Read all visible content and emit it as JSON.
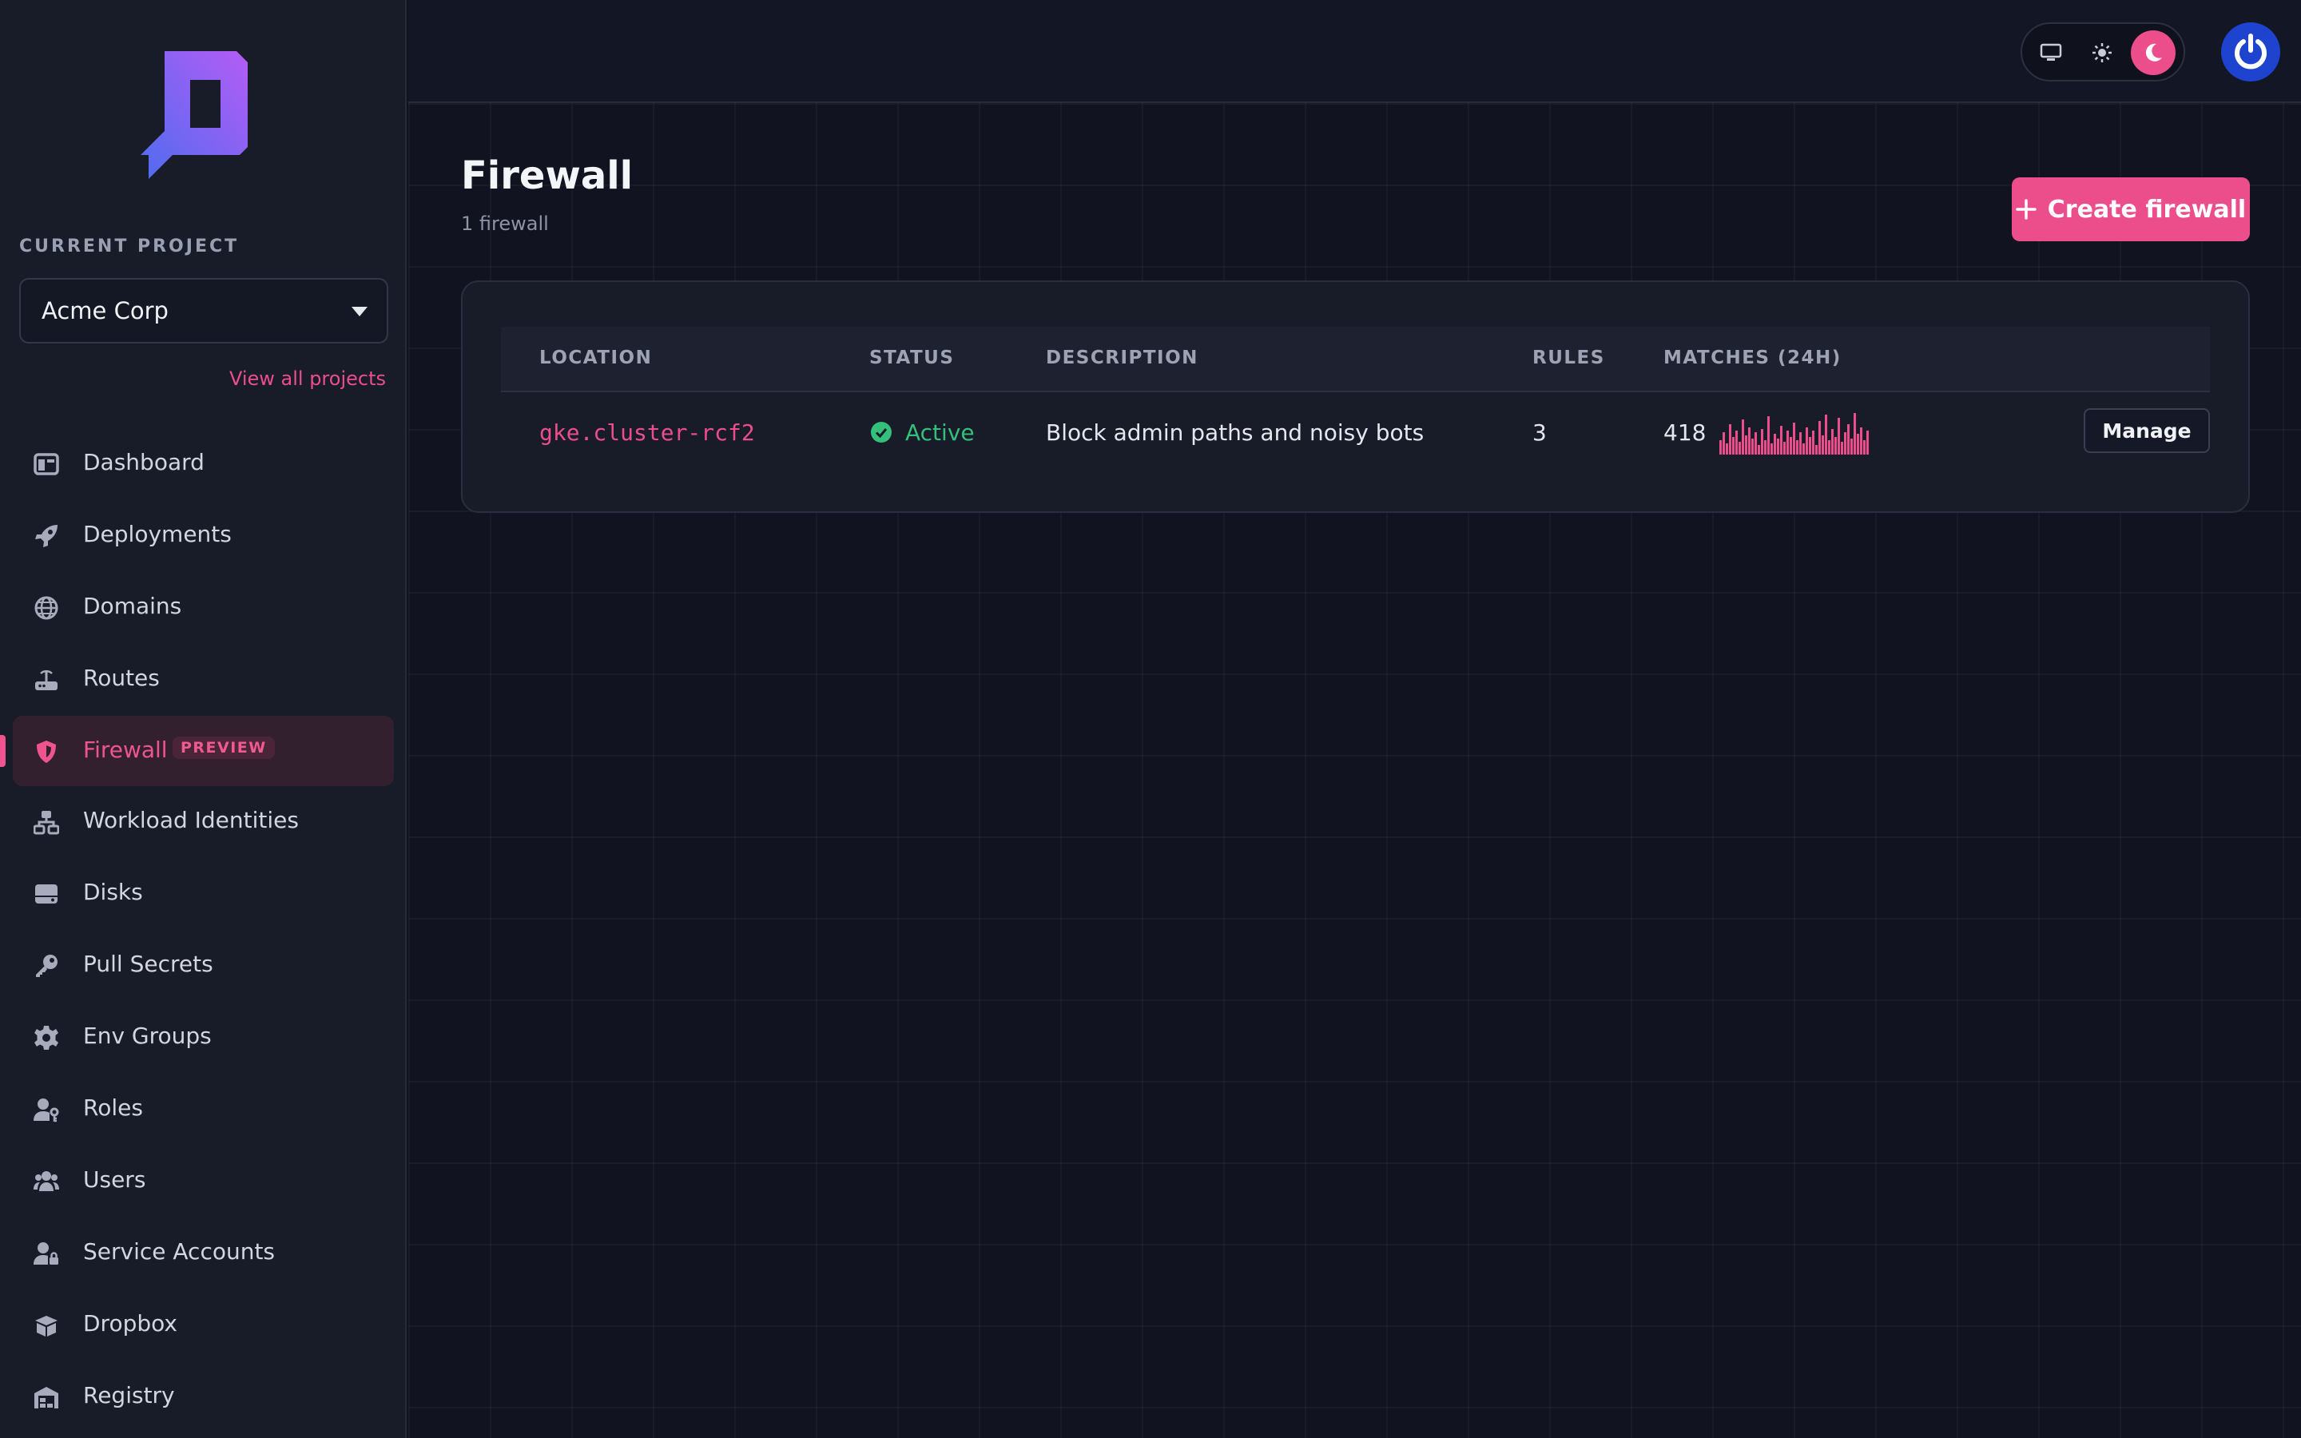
{
  "sidebar": {
    "current_project_label": "CURRENT PROJECT",
    "project_name": "Acme Corp",
    "view_all_projects": "View all projects",
    "items": [
      {
        "label": "Dashboard",
        "icon": "dashboard-icon"
      },
      {
        "label": "Deployments",
        "icon": "rocket-icon"
      },
      {
        "label": "Domains",
        "icon": "globe-icon"
      },
      {
        "label": "Routes",
        "icon": "router-icon"
      },
      {
        "label": "Firewall",
        "icon": "shield-icon",
        "active": true,
        "badge": "PREVIEW"
      },
      {
        "label": "Workload Identities",
        "icon": "network-icon"
      },
      {
        "label": "Disks",
        "icon": "disk-icon"
      },
      {
        "label": "Pull Secrets",
        "icon": "key-icon"
      },
      {
        "label": "Env Groups",
        "icon": "gear-icon"
      },
      {
        "label": "Roles",
        "icon": "user-key-icon"
      },
      {
        "label": "Users",
        "icon": "users-icon"
      },
      {
        "label": "Service Accounts",
        "icon": "user-lock-icon"
      },
      {
        "label": "Dropbox",
        "icon": "box-icon"
      },
      {
        "label": "Registry",
        "icon": "warehouse-icon"
      }
    ]
  },
  "header": {
    "theme_options": [
      "monitor-icon",
      "sun-icon",
      "moon-icon"
    ],
    "theme_selected": "dark"
  },
  "main": {
    "title": "Firewall",
    "subtitle": "1 firewall",
    "create_button": "Create firewall",
    "table": {
      "columns": [
        "LOCATION",
        "STATUS",
        "DESCRIPTION",
        "RULES",
        "MATCHES (24H)"
      ],
      "rows": [
        {
          "location": "gke.cluster-rcf2",
          "status": "Active",
          "description": "Block admin paths and noisy bots",
          "rules": "3",
          "matches": "418",
          "action": "Manage"
        }
      ]
    }
  },
  "colors": {
    "accent": "#ec4e8c",
    "status_active": "#34c07a",
    "background": "#111420",
    "sidebar": "#181b28"
  }
}
